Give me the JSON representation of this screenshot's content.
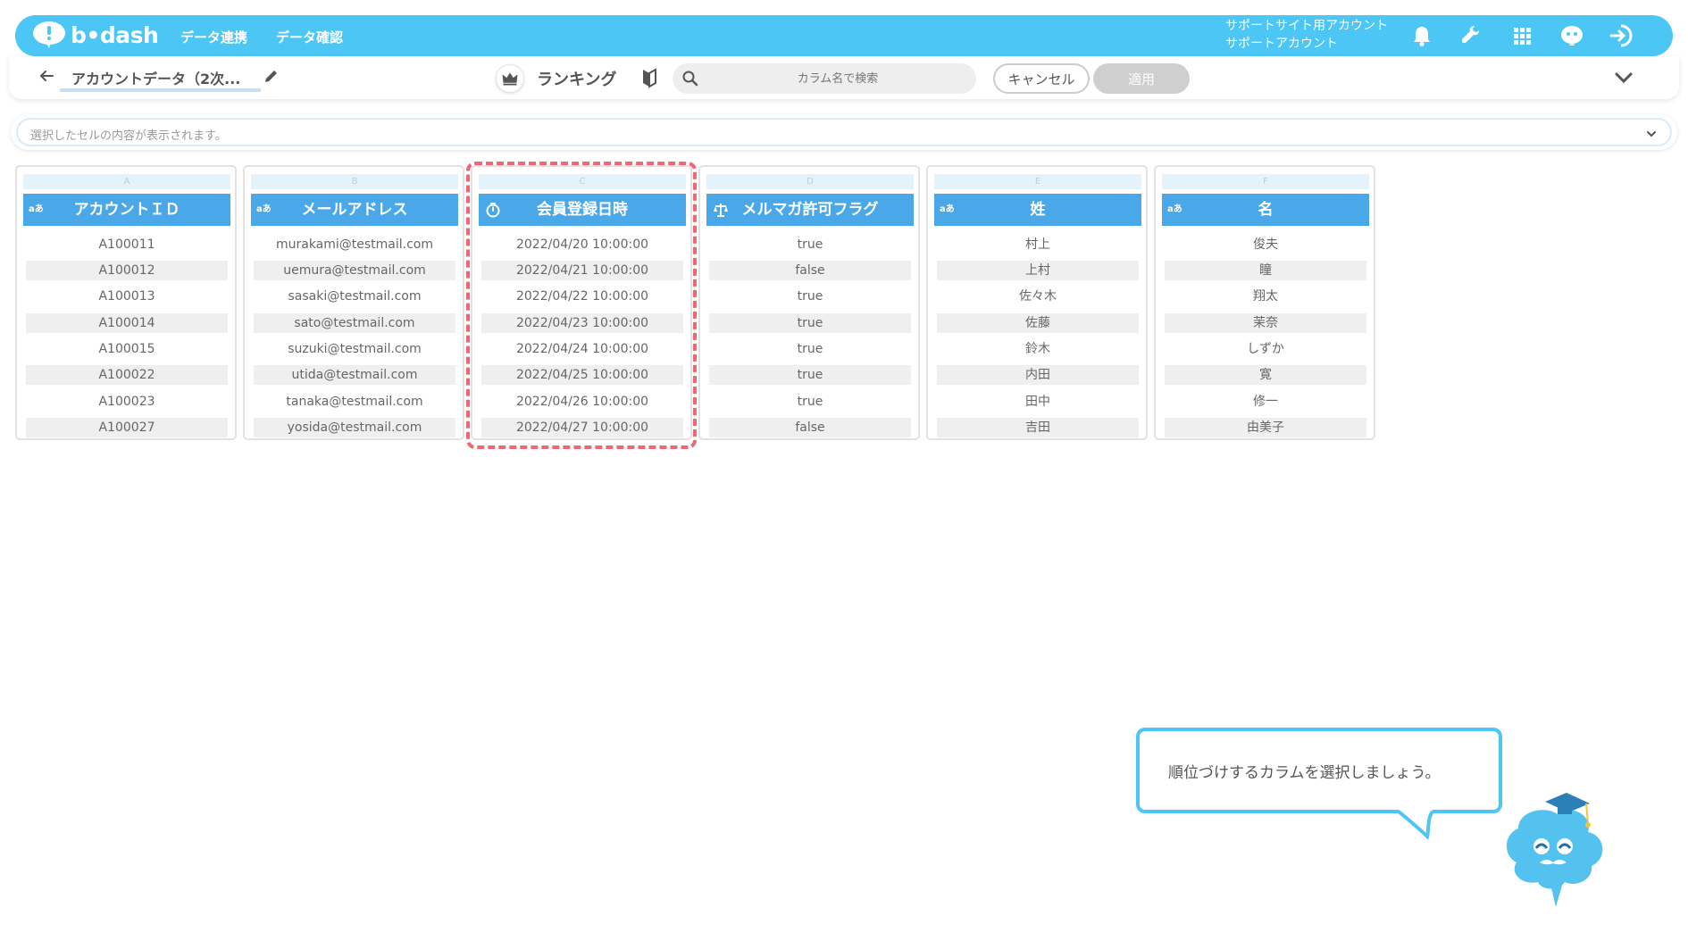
{
  "app": {
    "logo_text": "b•dash",
    "nav": [
      "データ連携",
      "データ確認"
    ],
    "account_line1": "サポートサイト用アカウント",
    "account_line2": "サポートアカウント"
  },
  "toolbar": {
    "dataset_title": "アカウントデータ（2次...",
    "ranking_label": "ランキング",
    "search_placeholder": "カラム名で検索",
    "cancel_label": "キャンセル",
    "apply_label": "適用"
  },
  "cellbar": {
    "placeholder": "選択したセルの内容が表示されます。"
  },
  "columns": [
    {
      "letter": "A",
      "type": "aあ",
      "header": "アカウントＩＤ",
      "cells": [
        "A100011",
        "A100012",
        "A100013",
        "A100014",
        "A100015",
        "A100022",
        "A100023",
        "A100027"
      ]
    },
    {
      "letter": "B",
      "type": "aあ",
      "header": "メールアドレス",
      "cells": [
        "murakami@testmail.com",
        "uemura@testmail.com",
        "sasaki@testmail.com",
        "sato@testmail.com",
        "suzuki@testmail.com",
        "utida@testmail.com",
        "tanaka@testmail.com",
        "yosida@testmail.com"
      ]
    },
    {
      "letter": "C",
      "type": "timer",
      "header": "会員登録日時",
      "cells": [
        "2022/04/20 10:00:00",
        "2022/04/21 10:00:00",
        "2022/04/22 10:00:00",
        "2022/04/23 10:00:00",
        "2022/04/24 10:00:00",
        "2022/04/25 10:00:00",
        "2022/04/26 10:00:00",
        "2022/04/27 10:00:00"
      ]
    },
    {
      "letter": "D",
      "type": "scale",
      "header": "メルマガ許可フラグ",
      "cells": [
        "true",
        "false",
        "true",
        "true",
        "true",
        "true",
        "true",
        "false"
      ]
    },
    {
      "letter": "E",
      "type": "aあ",
      "header": "姓",
      "cells": [
        "村上",
        "上村",
        "佐々木",
        "佐藤",
        "鈴木",
        "内田",
        "田中",
        "吉田"
      ]
    },
    {
      "letter": "F",
      "type": "aあ",
      "header": "名",
      "cells": [
        "俊夫",
        "瞳",
        "翔太",
        "茉奈",
        "しずか",
        "寛",
        "修一",
        "由美子"
      ]
    }
  ],
  "guide": {
    "message": "順位づけするカラムを選択しましょう。"
  },
  "colors": {
    "brand": "#4cc6f4",
    "header": "#4aa8e8",
    "highlight": "#f06674"
  }
}
